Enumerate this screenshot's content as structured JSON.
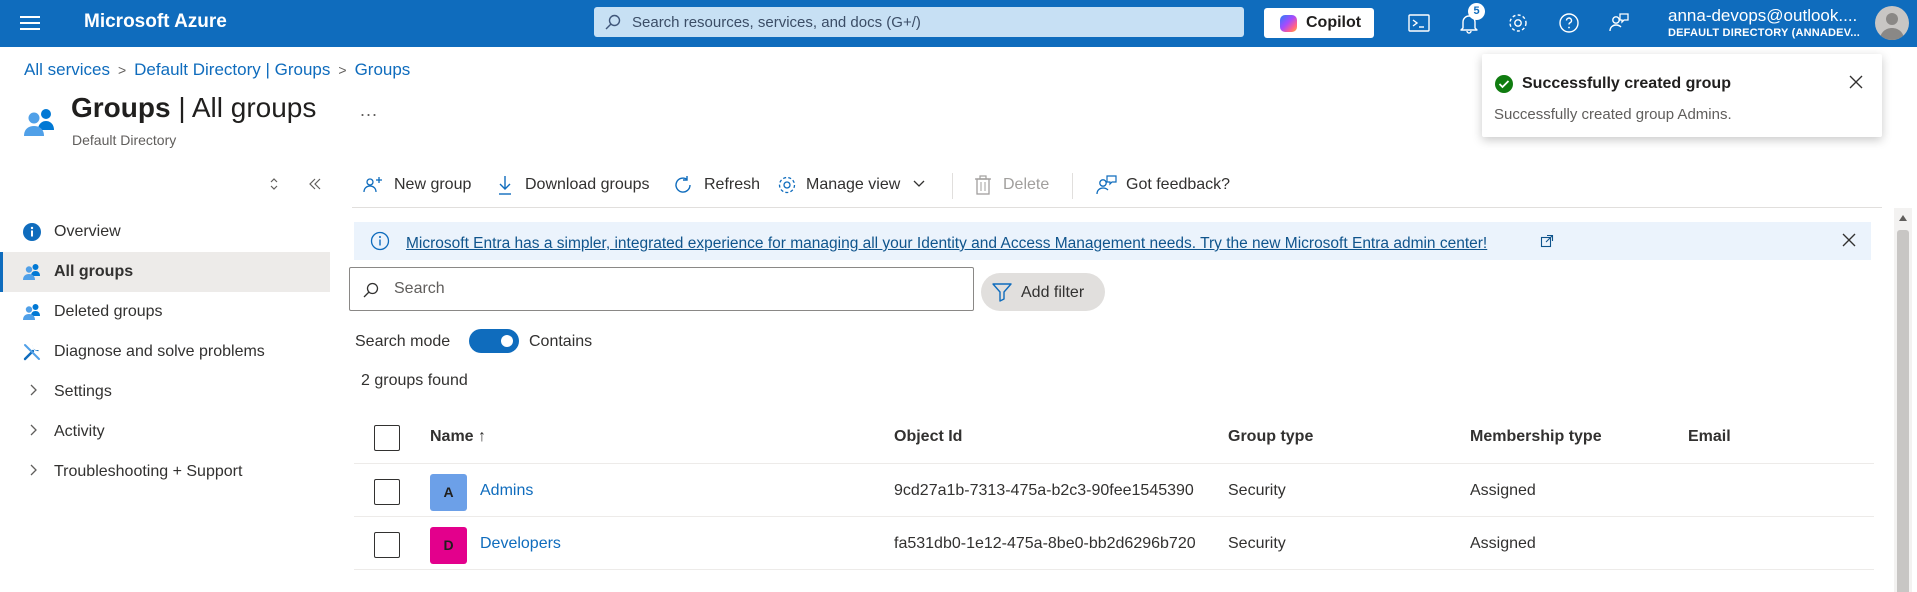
{
  "topbar": {
    "app_title": "Microsoft Azure",
    "search_placeholder": "Search resources, services, and docs (G+/)",
    "copilot_label": "Copilot",
    "notification_count": "5",
    "account_name": "anna-devops@outlook....",
    "account_directory": "DEFAULT DIRECTORY (ANNADEV..."
  },
  "breadcrumb": [
    "All services",
    "Default Directory | Groups",
    "Groups"
  ],
  "page": {
    "title_main": "Groups",
    "title_sep": " | ",
    "title_sub": "All groups",
    "more": "...",
    "subtitle": "Default Directory"
  },
  "sidebar": {
    "items": [
      {
        "label": "Overview",
        "icon": "info-icon"
      },
      {
        "label": "All groups",
        "icon": "group-icon",
        "active": true
      },
      {
        "label": "Deleted groups",
        "icon": "group-icon"
      },
      {
        "label": "Diagnose and solve problems",
        "icon": "wrench-icon"
      },
      {
        "label": "Settings",
        "icon": "chevron-right-icon"
      },
      {
        "label": "Activity",
        "icon": "chevron-right-icon"
      },
      {
        "label": "Troubleshooting + Support",
        "icon": "chevron-right-icon"
      }
    ]
  },
  "commands": {
    "new_group": "New group",
    "download_groups": "Download groups",
    "refresh": "Refresh",
    "manage_view": "Manage view",
    "delete": "Delete",
    "feedback": "Got feedback?"
  },
  "banner": {
    "text": "Microsoft Entra has a simpler, integrated experience for managing all your Identity and Access Management needs. Try the new Microsoft Entra admin center!"
  },
  "search": {
    "placeholder": "Search",
    "add_filter": "Add filter",
    "mode_label": "Search mode",
    "mode_value": "Contains",
    "mode_on": true
  },
  "results": {
    "count_text": "2 groups found"
  },
  "table": {
    "headers": {
      "name": "Name ↑",
      "object_id": "Object Id",
      "group_type": "Group type",
      "membership_type": "Membership type",
      "email": "Email"
    },
    "rows": [
      {
        "initial": "A",
        "name": "Admins",
        "object_id": "9cd27a1b-7313-475a-b2c3-90fee1545390",
        "group_type": "Security",
        "membership_type": "Assigned",
        "email": "",
        "avatar_color": "#6ca0e8"
      },
      {
        "initial": "D",
        "name": "Developers",
        "object_id": "fa531db0-1e12-475a-8be0-bb2d6296b720",
        "group_type": "Security",
        "membership_type": "Assigned",
        "email": "",
        "avatar_color": "#e3008c"
      }
    ]
  },
  "toast": {
    "title": "Successfully created group",
    "message": "Successfully created group Admins."
  },
  "colors": {
    "accent": "#0f6cbd",
    "success": "#107c10"
  }
}
